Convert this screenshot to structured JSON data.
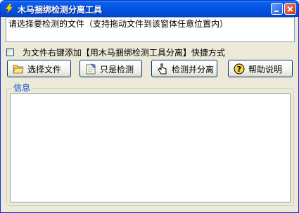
{
  "window": {
    "title": "木马捆绑检测分离工具",
    "icon": "lightning-icon"
  },
  "path_field": {
    "value": "请选择要检测的文件（支持拖动文件到该窗体任意位置内）"
  },
  "context_menu_option": {
    "label": "为文件右键添加【用木马捆绑检测工具分离】快捷方式",
    "checked": false
  },
  "buttons": {
    "select_file": {
      "label": "选择文件",
      "icon": "folder-open-icon"
    },
    "detect_only": {
      "label": "只是检测",
      "icon": "notepad-check-icon"
    },
    "detect_and_separate": {
      "label": "检测并分离",
      "icon": "hand-pointer-icon"
    },
    "help": {
      "label": "帮助说明",
      "icon": "help-question-icon"
    }
  },
  "info_group": {
    "title": "信息",
    "content": ""
  },
  "colors": {
    "titlebar": "#0354e3",
    "window_bg": "#ece9d8",
    "group_title": "#0046d5"
  }
}
